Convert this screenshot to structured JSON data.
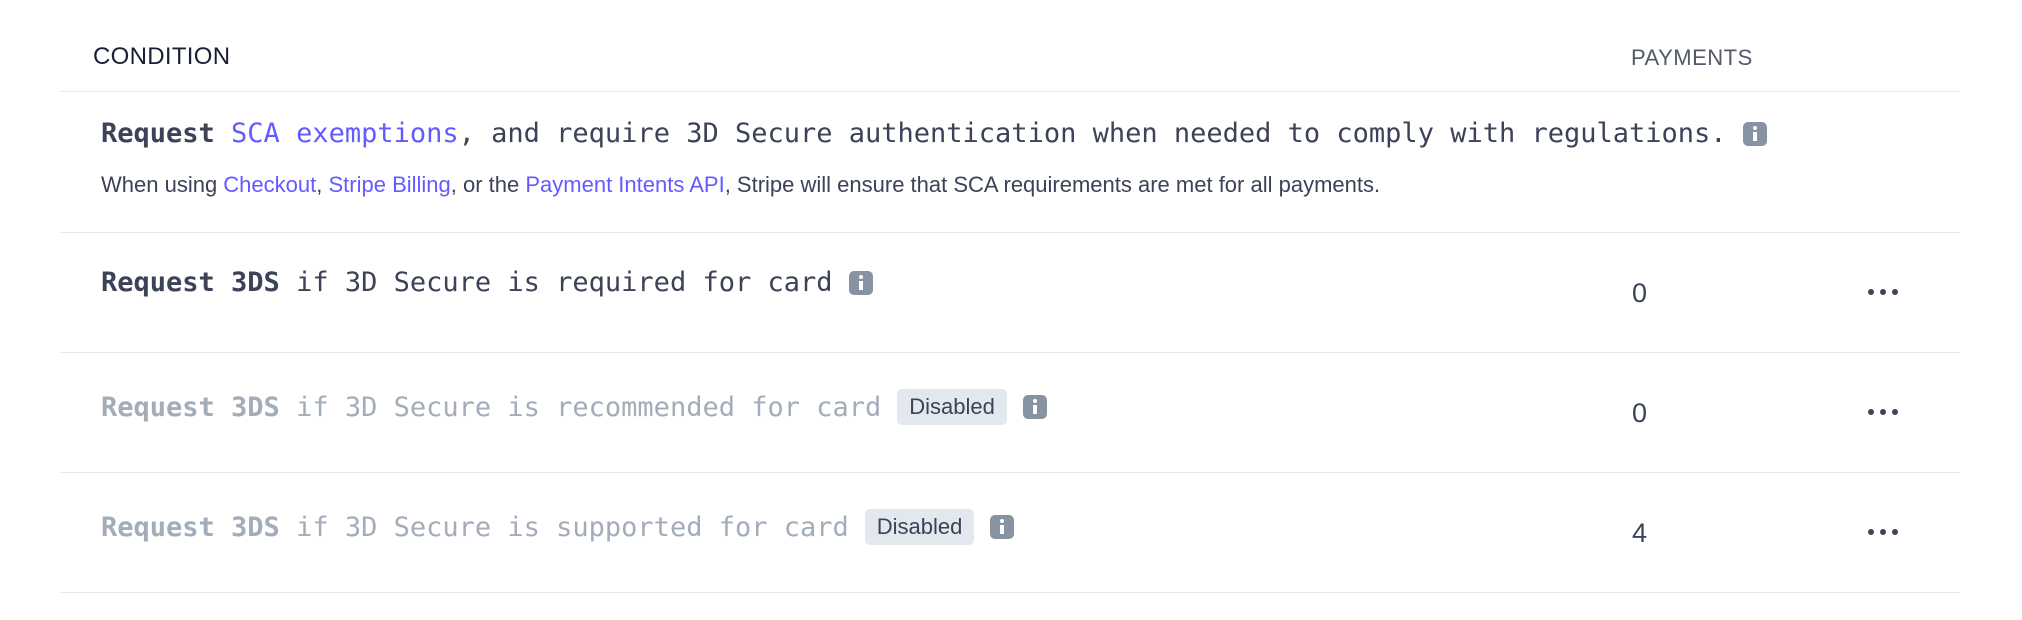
{
  "table": {
    "headers": {
      "condition": "CONDITION",
      "payments": "PAYMENTS"
    },
    "sca_row": {
      "part1": "Request ",
      "link": "SCA exemptions",
      "part2": ", and require 3D Secure authentication when needed to comply with regulations.",
      "sub_prefix": "When using ",
      "sub_link1": "Checkout",
      "sub_sep1": ", ",
      "sub_link2": "Stripe Billing",
      "sub_sep2": ", or the ",
      "sub_link3": "Payment Intents API",
      "sub_suffix": ", Stripe will ensure that SCA requirements are met for all payments."
    },
    "rules": [
      {
        "action": "Request 3DS",
        "condition": " if 3D Secure is required for card",
        "badge": "",
        "payments": "0",
        "disabled": false
      },
      {
        "action": "Request 3DS",
        "condition": " if 3D Secure is recommended for card",
        "badge": "Disabled",
        "payments": "0",
        "disabled": true
      },
      {
        "action": "Request 3DS",
        "condition": " if 3D Secure is supported for card",
        "badge": "Disabled",
        "payments": "4",
        "disabled": true
      }
    ]
  },
  "icons": {
    "info": "info-icon",
    "more": "more-horizontal-icon"
  },
  "colors": {
    "link": "#635bff",
    "text": "#3c4257",
    "disabled_text": "#a3acb9",
    "badge_bg": "#e3e8ee",
    "divider": "#e3e8ee"
  }
}
